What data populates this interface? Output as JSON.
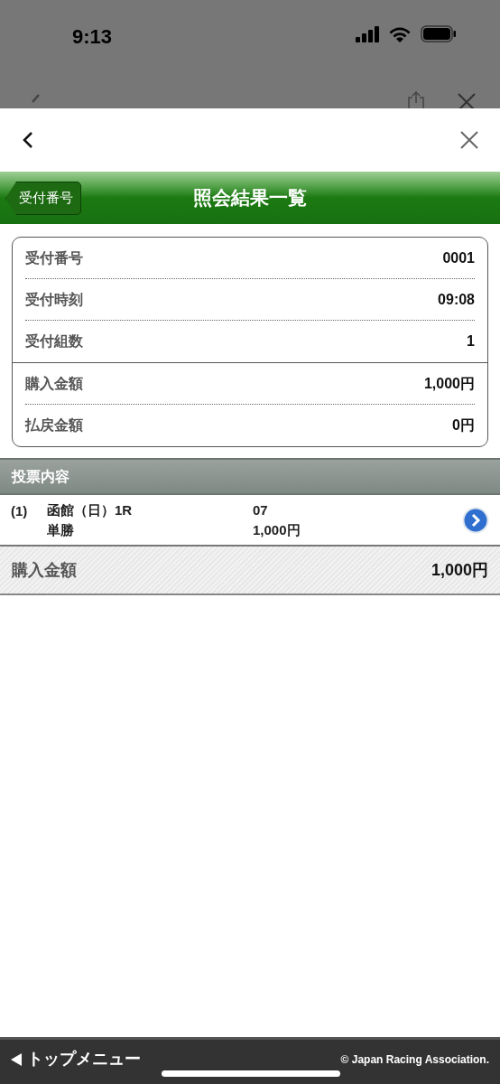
{
  "status_bar": {
    "time": "9:13"
  },
  "header": {
    "back_label": "受付番号",
    "title": "照会結果一覧"
  },
  "summary": {
    "groups": [
      [
        {
          "label": "受付番号",
          "value": "0001"
        },
        {
          "label": "受付時刻",
          "value": "09:08"
        },
        {
          "label": "受付組数",
          "value": "1"
        }
      ],
      [
        {
          "label": "購入金額",
          "value": "1,000円"
        },
        {
          "label": "払戻金額",
          "value": "0円"
        }
      ]
    ]
  },
  "votes": {
    "heading": "投票内容",
    "items": [
      {
        "number": "(1)",
        "race": "函館（日）1R",
        "bet_type": "単勝",
        "horse": "07",
        "amount": "1,000円"
      }
    ]
  },
  "total": {
    "label": "購入金額",
    "value": "1,000円"
  },
  "footer": {
    "menu_link": "トップメニュー",
    "copyright": "© Japan Racing Association."
  }
}
